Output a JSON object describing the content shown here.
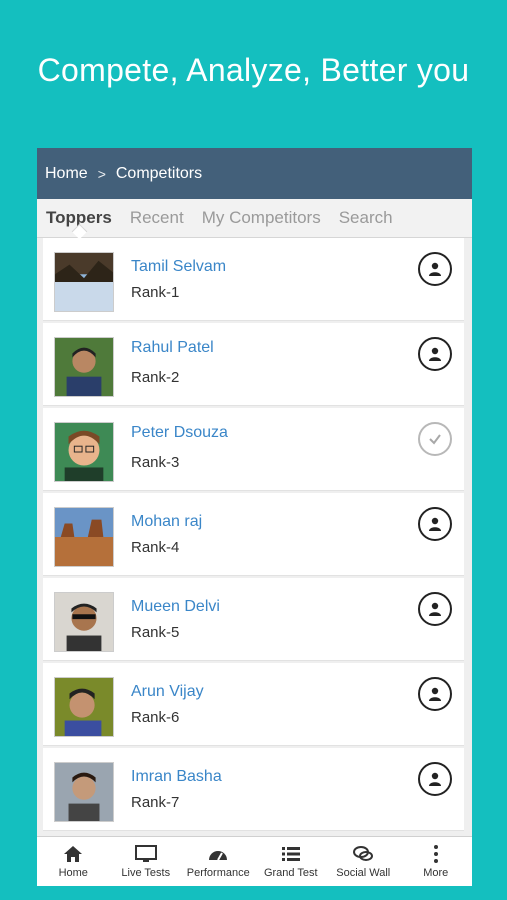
{
  "tagline": "Compete, Analyze, Better you",
  "breadcrumb": {
    "home": "Home",
    "separator": ">",
    "current": "Competitors"
  },
  "tabs": [
    {
      "label": "Toppers",
      "active": true
    },
    {
      "label": "Recent",
      "active": false
    },
    {
      "label": "My Competitors",
      "active": false
    },
    {
      "label": "Search",
      "active": false
    }
  ],
  "competitors": [
    {
      "name": "Tamil Selvam",
      "rank": "Rank-1",
      "action": "user-icon"
    },
    {
      "name": "Rahul Patel",
      "rank": "Rank-2",
      "action": "user-icon"
    },
    {
      "name": "Peter Dsouza",
      "rank": "Rank-3",
      "action": "check-icon"
    },
    {
      "name": "Mohan raj",
      "rank": "Rank-4",
      "action": "user-icon"
    },
    {
      "name": "Mueen Delvi",
      "rank": "Rank-5",
      "action": "user-icon"
    },
    {
      "name": "Arun Vijay",
      "rank": "Rank-6",
      "action": "user-icon"
    },
    {
      "name": "Imran Basha",
      "rank": "Rank-7",
      "action": "user-icon"
    }
  ],
  "bottom_nav": [
    {
      "label": "Home",
      "icon": "home-icon"
    },
    {
      "label": "Live Tests",
      "icon": "monitor-icon"
    },
    {
      "label": "Performance",
      "icon": "gauge-icon"
    },
    {
      "label": "Grand Test",
      "icon": "list-icon"
    },
    {
      "label": "Social Wall",
      "icon": "chat-icon"
    },
    {
      "label": "More",
      "icon": "more-icon"
    }
  ],
  "colors": {
    "background": "#14bfbf",
    "breadcrumb_bar": "#43607a",
    "link": "#3a86c8"
  }
}
